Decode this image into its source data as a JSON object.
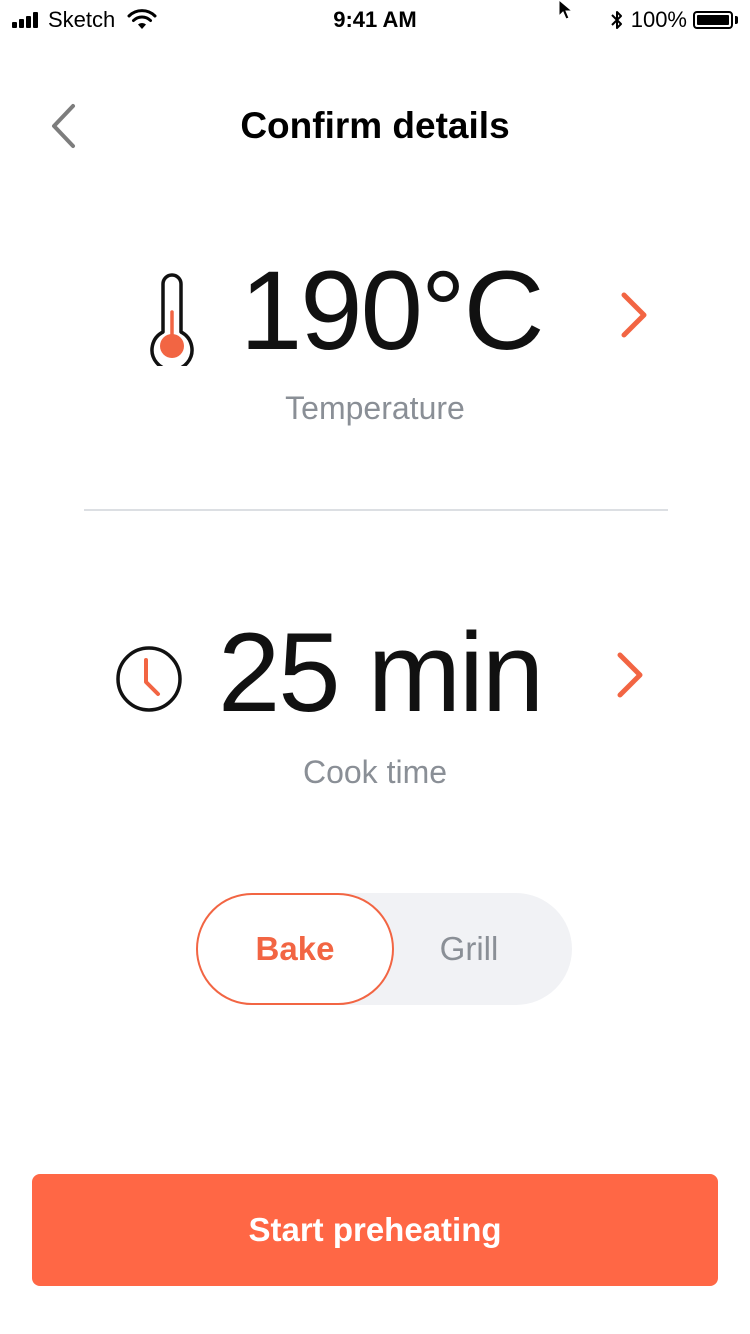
{
  "status_bar": {
    "carrier": "Sketch",
    "time": "9:41 AM",
    "battery": "100%"
  },
  "header": {
    "title": "Confirm details",
    "back_icon": "chevron-left-icon"
  },
  "temperature": {
    "value": "190°C",
    "label": "Temperature",
    "icon": "thermometer-icon"
  },
  "cook_time": {
    "value": "25 min",
    "label": "Cook time",
    "icon": "clock-icon"
  },
  "mode": {
    "options": [
      "Bake",
      "Grill"
    ],
    "selected": "Bake"
  },
  "actions": {
    "primary_label": "Start preheating"
  },
  "colors": {
    "accent": "#ff6745",
    "accent_text": "#f26543",
    "muted_text": "#8a8f96",
    "toggle_bg": "#f1f2f5",
    "divider": "#dcdfe3"
  }
}
